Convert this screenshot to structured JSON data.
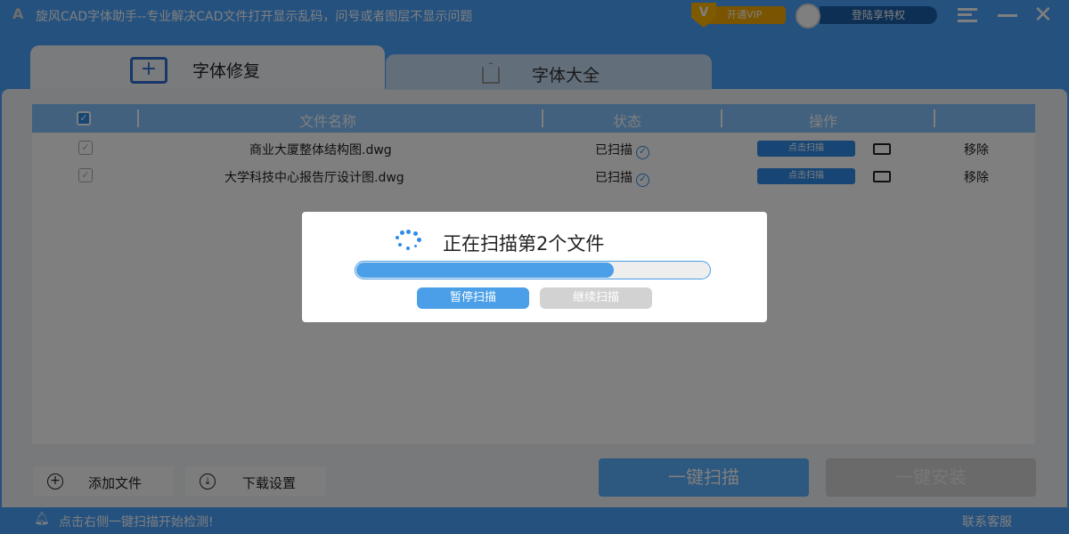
{
  "app": {
    "title": "旋风CAD字体助手--专业解决CAD文件打开显示乱码，问号或者图层不显示问题",
    "logo": "A",
    "vip": "开通VIP",
    "vip_badge": "V",
    "login": "登陆享特权"
  },
  "tabs": [
    {
      "label": "字体修复"
    },
    {
      "label": "字体大全"
    }
  ],
  "table": {
    "headers": [
      "文件名称",
      "状态",
      "操作"
    ],
    "rows": [
      {
        "name": "商业大厦整体结构图.dwg",
        "status": "已扫描",
        "action": "点击扫描",
        "remove": "移除"
      },
      {
        "name": "大学科技中心报告厅设计图.dwg",
        "status": "已扫描",
        "action": "点击扫描",
        "remove": "移除"
      }
    ]
  },
  "buttons": {
    "add_file": "添加文件",
    "download_settings": "下载设置",
    "scan_all": "一键扫描",
    "install_all": "一键安装"
  },
  "status": {
    "message": "点击右侧一键扫描开始检测!",
    "support": "联系客服"
  },
  "dialog": {
    "title": "正在扫描第2个文件",
    "progress_percent": 73,
    "pause": "暂停扫描",
    "resume": "继续扫描"
  },
  "colors": {
    "primary": "#4aa3ff",
    "button": "#2e8ce8"
  }
}
